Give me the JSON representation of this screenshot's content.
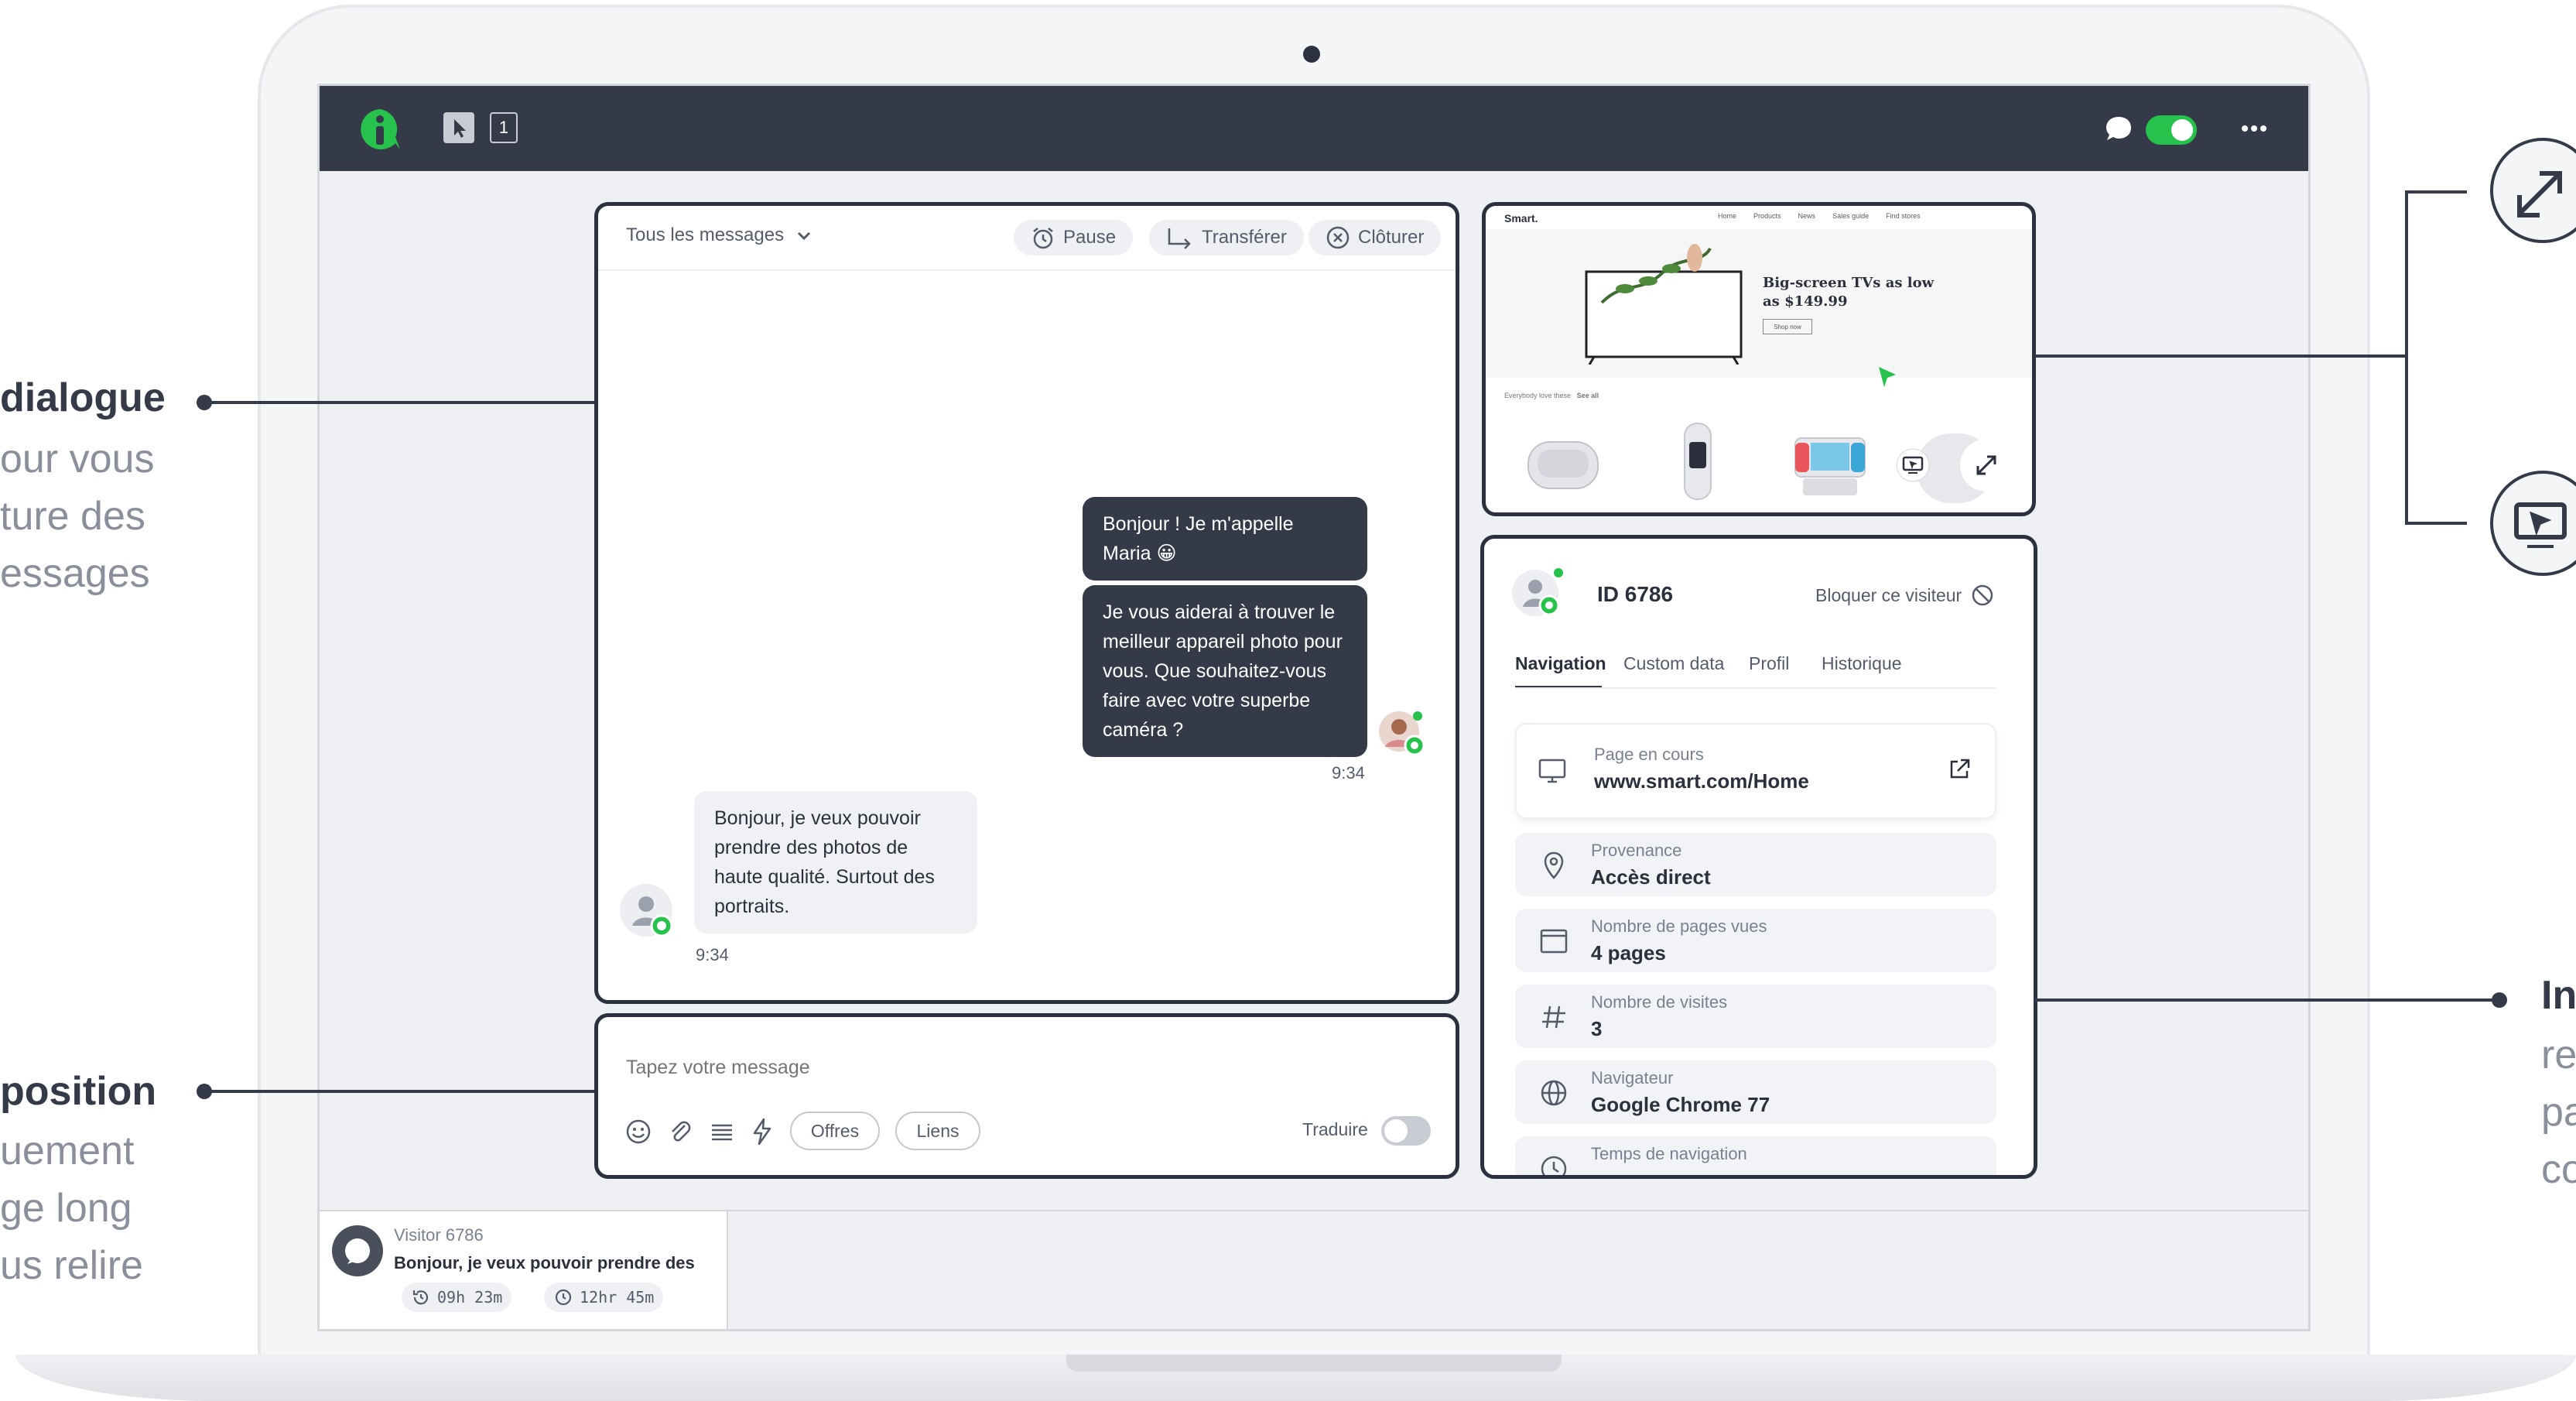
{
  "callouts": {
    "left_top": {
      "title": "dialogue",
      "lines": [
        "our vous",
        "ture des",
        "essages"
      ]
    },
    "left_bottom": {
      "title": "position",
      "lines": [
        "uement",
        "ge long",
        "us relire"
      ]
    },
    "right": {
      "title": "In",
      "lines": [
        "re",
        "pa",
        "co"
      ]
    }
  },
  "topbar": {
    "counter": "1"
  },
  "chat": {
    "filter_label": "Tous les messages",
    "actions": {
      "pause": "Pause",
      "transfer": "Transférer",
      "close": "Clôturer"
    },
    "messages": [
      {
        "from": "agent",
        "text": "Bonjour ! Je m'appelle Maria 😀"
      },
      {
        "from": "agent",
        "text": "Je vous aiderai à trouver le meilleur appareil photo pour vous. Que souhaitez-vous faire avec votre superbe caméra ?"
      },
      {
        "from": "visitor",
        "text": "Bonjour, je veux pouvoir prendre des photos de haute qualité. Surtout des portraits."
      }
    ],
    "agent_time": "9:34",
    "visitor_time": "9:34"
  },
  "composer": {
    "placeholder": "Tapez votre message",
    "offers_label": "Offres",
    "links_label": "Liens",
    "translate_label": "Traduire"
  },
  "preview": {
    "brand": "Smart.",
    "nav": [
      "Home",
      "Products",
      "News",
      "Sales guide",
      "Find stores"
    ],
    "headline": "Big-screen TVs as low as $149.99",
    "shop_btn": "Shop now",
    "row_label": "Everybody love these",
    "row_link": "See all"
  },
  "visitor": {
    "id_label": "ID 6786",
    "block_label": "Bloquer ce visiteur",
    "tabs": [
      "Navigation",
      "Custom data",
      "Profil",
      "Historique"
    ],
    "active_tab": "Navigation",
    "current_page": {
      "label": "Page en cours",
      "value": "www.smart.com/Home"
    },
    "info": [
      {
        "label": "Provenance",
        "value": "Accès direct",
        "icon": "location-pin-icon"
      },
      {
        "label": "Nombre de pages vues",
        "value": "4 pages",
        "icon": "browser-window-icon"
      },
      {
        "label": "Nombre de visites",
        "value": "3",
        "icon": "hash-icon"
      },
      {
        "label": "Navigateur",
        "value": "Google Chrome 77",
        "icon": "globe-icon"
      },
      {
        "label": "Temps de navigation",
        "value": "",
        "icon": "clock-icon"
      }
    ]
  },
  "conversation_item": {
    "name": "Visitor 6786",
    "preview": "Bonjour, je veux pouvoir prendre des",
    "duration": "09h 23m",
    "wait": "12hr 45m"
  },
  "colors": {
    "accent": "#27c24c",
    "dark": "#353a48",
    "background": "#eef0f4"
  }
}
